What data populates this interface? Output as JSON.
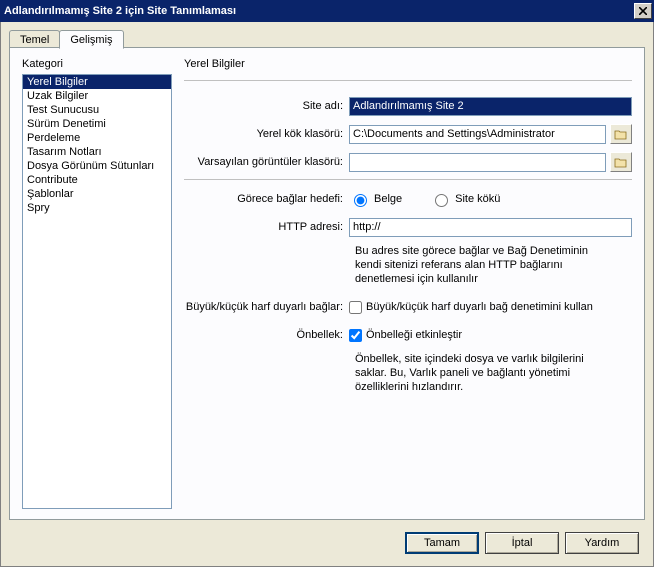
{
  "title": "Adlandırılmamış Site 2 için Site Tanımlaması",
  "tabs": {
    "basic": "Temel",
    "advanced": "Gelişmiş"
  },
  "category_heading": "Kategori",
  "categories": [
    "Yerel Bilgiler",
    "Uzak Bilgiler",
    "Test Sunucusu",
    "Sürüm Denetimi",
    "Perdeleme",
    "Tasarım Notları",
    "Dosya Görünüm Sütunları",
    "Contribute",
    "Şablonlar",
    "Spry"
  ],
  "panel_heading": "Yerel Bilgiler",
  "labels": {
    "site_name": "Site adı:",
    "local_root": "Yerel kök klasörü:",
    "default_images": "Varsayılan görüntüler klasörü:",
    "relative_links": "Görece bağlar hedefi:",
    "http_address": "HTTP adresi:",
    "case_links": "Büyük/küçük harf duyarlı bağlar:",
    "cache": "Önbellek:"
  },
  "values": {
    "site_name": "Adlandırılmamış Site 2",
    "local_root": "C:\\Documents and Settings\\Administrator",
    "default_images": "",
    "http_address": "http://"
  },
  "radios": {
    "document": "Belge",
    "site_root": "Site kökü"
  },
  "checkboxes": {
    "case_sensitive": "Büyük/küçük harf duyarlı bağ denetimini kullan",
    "enable_cache": "Önbelleği etkinleştir"
  },
  "help_http": "Bu adres site görece bağlar ve Bağ Denetiminin kendi sitenizi referans alan HTTP bağlarını denetlemesi için kullanılır",
  "help_cache": "Önbellek, site içindeki dosya ve varlık bilgilerini saklar. Bu, Varlık paneli ve bağlantı yönetimi özelliklerini hızlandırır.",
  "buttons": {
    "ok": "Tamam",
    "cancel": "İptal",
    "help": "Yardım"
  }
}
